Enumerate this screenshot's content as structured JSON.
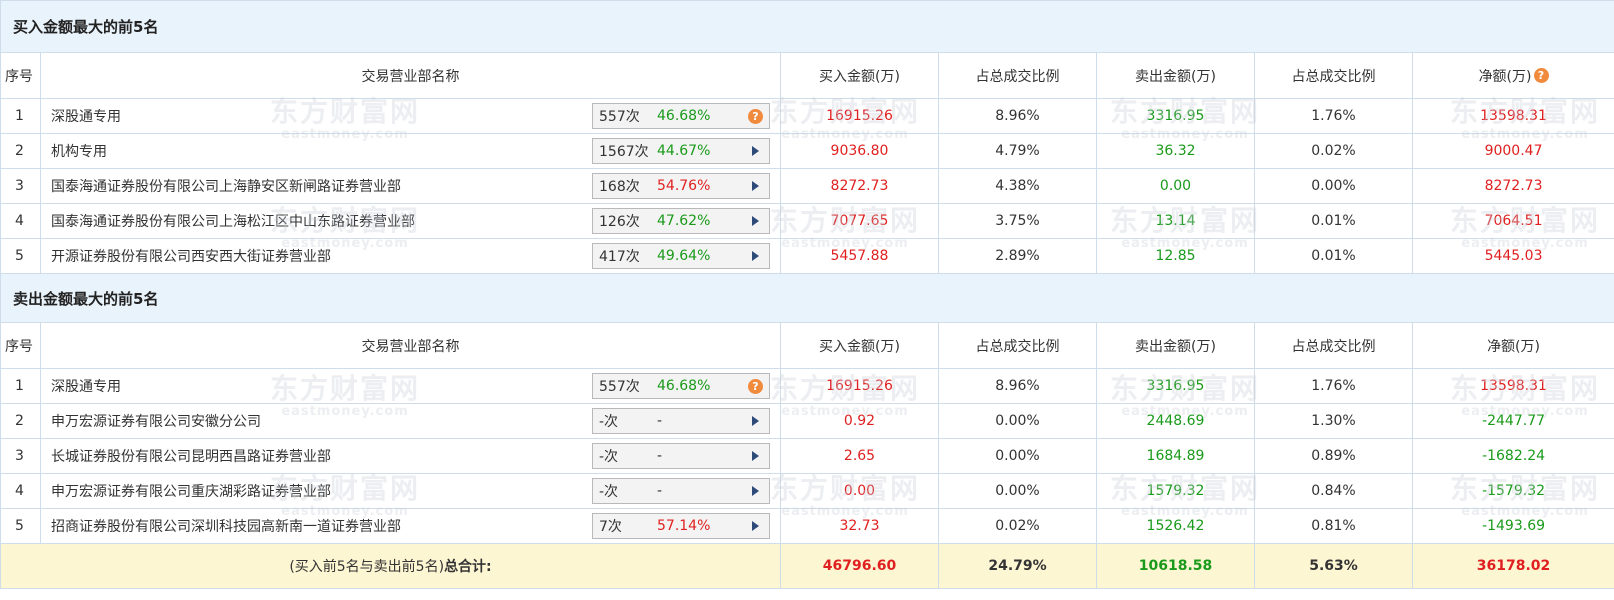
{
  "buy_section": {
    "title": "买入金额最大的前5名",
    "headers": {
      "seq": "序号",
      "name": "交易营业部名称",
      "buy": "买入金额(万)",
      "buy_ratio": "占总成交比例",
      "sell": "卖出金额(万)",
      "sell_ratio": "占总成交比例",
      "net": "净额(万)"
    },
    "rows": [
      {
        "seq": "1",
        "name": "深股通专用",
        "times": "557次",
        "rate": "46.68%",
        "rate_color": "green",
        "icon": "question-icon",
        "buy": "16915.26",
        "buy_ratio": "8.96%",
        "sell": "3316.95",
        "sell_ratio": "1.76%",
        "net": "13598.31",
        "net_color": "red"
      },
      {
        "seq": "2",
        "name": "机构专用",
        "times": "1567次",
        "rate": "44.67%",
        "rate_color": "green",
        "icon": "arrow-right-icon",
        "buy": "9036.80",
        "buy_ratio": "4.79%",
        "sell": "36.32",
        "sell_ratio": "0.02%",
        "net": "9000.47",
        "net_color": "red"
      },
      {
        "seq": "3",
        "name": "国泰海通证券股份有限公司上海静安区新闸路证券营业部",
        "times": "168次",
        "rate": "54.76%",
        "rate_color": "red",
        "icon": "arrow-right-icon",
        "buy": "8272.73",
        "buy_ratio": "4.38%",
        "sell": "0.00",
        "sell_ratio": "0.00%",
        "net": "8272.73",
        "net_color": "red"
      },
      {
        "seq": "4",
        "name": "国泰海通证券股份有限公司上海松江区中山东路证券营业部",
        "times": "126次",
        "rate": "47.62%",
        "rate_color": "green",
        "icon": "arrow-right-icon",
        "buy": "7077.65",
        "buy_ratio": "3.75%",
        "sell": "13.14",
        "sell_ratio": "0.01%",
        "net": "7064.51",
        "net_color": "red"
      },
      {
        "seq": "5",
        "name": "开源证券股份有限公司西安西大街证券营业部",
        "times": "417次",
        "rate": "49.64%",
        "rate_color": "green",
        "icon": "arrow-right-icon",
        "buy": "5457.88",
        "buy_ratio": "2.89%",
        "sell": "12.85",
        "sell_ratio": "0.01%",
        "net": "5445.03",
        "net_color": "red"
      }
    ]
  },
  "sell_section": {
    "title": "卖出金额最大的前5名",
    "headers": {
      "seq": "序号",
      "name": "交易营业部名称",
      "buy": "买入金额(万)",
      "buy_ratio": "占总成交比例",
      "sell": "卖出金额(万)",
      "sell_ratio": "占总成交比例",
      "net": "净额(万)"
    },
    "rows": [
      {
        "seq": "1",
        "name": "深股通专用",
        "times": "557次",
        "rate": "46.68%",
        "rate_color": "green",
        "icon": "question-icon",
        "buy": "16915.26",
        "buy_ratio": "8.96%",
        "sell": "3316.95",
        "sell_ratio": "1.76%",
        "net": "13598.31",
        "net_color": "red"
      },
      {
        "seq": "2",
        "name": "申万宏源证券有限公司安徽分公司",
        "times": "-次",
        "rate": "-",
        "rate_color": "grey",
        "icon": "arrow-right-icon",
        "buy": "0.92",
        "buy_ratio": "0.00%",
        "sell": "2448.69",
        "sell_ratio": "1.30%",
        "net": "-2447.77",
        "net_color": "green"
      },
      {
        "seq": "3",
        "name": "长城证券股份有限公司昆明西昌路证券营业部",
        "times": "-次",
        "rate": "-",
        "rate_color": "grey",
        "icon": "arrow-right-icon",
        "buy": "2.65",
        "buy_ratio": "0.00%",
        "sell": "1684.89",
        "sell_ratio": "0.89%",
        "net": "-1682.24",
        "net_color": "green"
      },
      {
        "seq": "4",
        "name": "申万宏源证券有限公司重庆湖彩路证券营业部",
        "times": "-次",
        "rate": "-",
        "rate_color": "grey",
        "icon": "arrow-right-icon",
        "buy": "0.00",
        "buy_ratio": "0.00%",
        "sell": "1579.32",
        "sell_ratio": "0.84%",
        "net": "-1579.32",
        "net_color": "green"
      },
      {
        "seq": "5",
        "name": "招商证券股份有限公司深圳科技园高新南一道证券营业部",
        "times": "7次",
        "rate": "57.14%",
        "rate_color": "red",
        "icon": "arrow-right-icon",
        "buy": "32.73",
        "buy_ratio": "0.02%",
        "sell": "1526.42",
        "sell_ratio": "0.81%",
        "net": "-1493.69",
        "net_color": "green"
      }
    ]
  },
  "total": {
    "label_prefix": "(买入前5名与卖出前5名)",
    "label_bold": "总合计:",
    "buy": "46796.60",
    "buy_ratio": "24.79%",
    "sell": "10618.58",
    "sell_ratio": "5.63%",
    "net": "36178.02"
  },
  "watermark": {
    "cn": "东方财富网",
    "en": "eastmoney.com"
  },
  "colors": {
    "red": "#e02020",
    "green": "#1a9a1a",
    "header_bg": "#e9f3fb",
    "total_bg": "#fdf6d3",
    "question_icon": "#f08a3c",
    "arrow_icon": "#2d4a78"
  },
  "icons": {
    "question": "?"
  }
}
